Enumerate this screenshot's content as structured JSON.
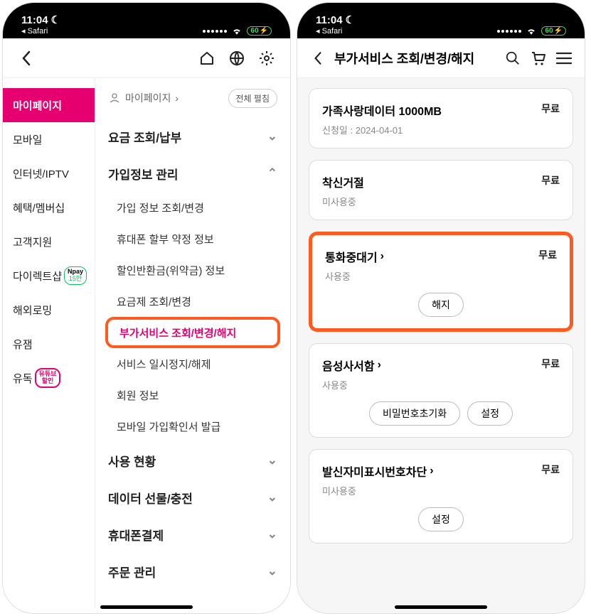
{
  "status": {
    "time": "11:04",
    "back_app": "Safari",
    "battery": "60"
  },
  "left": {
    "sidebar": [
      {
        "label": "마이페이지",
        "active": true
      },
      {
        "label": "모바일"
      },
      {
        "label": "인터넷/IPTV"
      },
      {
        "label": "혜택/멤버십"
      },
      {
        "label": "고객지원"
      },
      {
        "label": "다이렉트샵",
        "badge": "npay",
        "badge_top": "Npay",
        "badge_bot": "15만"
      },
      {
        "label": "해외로밍"
      },
      {
        "label": "유잼"
      },
      {
        "label": "유독",
        "badge": "yt",
        "badge_text": "유튜브\n할인"
      }
    ],
    "crumb": "마이페이지",
    "expand_all": "전체 펼침",
    "sections": [
      {
        "title": "요금 조회/납부",
        "open": false
      },
      {
        "title": "가입정보 관리",
        "open": true,
        "items": [
          "가입 정보 조회/변경",
          "휴대폰 할부 약정 정보",
          "할인반환금(위약금) 정보",
          "요금제 조회/변경",
          "부가서비스 조회/변경/해지",
          "서비스 일시정지/해제",
          "회원 정보",
          "모바일 가입확인서 발급"
        ],
        "highlight_index": 4
      },
      {
        "title": "사용 현황",
        "open": false
      },
      {
        "title": "데이터 선물/충전",
        "open": false
      },
      {
        "title": "휴대폰결제",
        "open": false
      },
      {
        "title": "주문 관리",
        "open": false
      }
    ]
  },
  "right": {
    "page_title": "부가서비스 조회/변경/해지",
    "cards": [
      {
        "title": "가족사랑데이터 1000MB",
        "sub_label": "신청일 : 2024-04-01",
        "price": "무료"
      },
      {
        "title": "착신거절",
        "sub_label": "미사용중",
        "price": "무료"
      },
      {
        "title": "통화중대기",
        "sub_label": "사용중",
        "price": "무료",
        "arrow": true,
        "actions": [
          "해지"
        ],
        "highlight": true
      },
      {
        "title": "음성사서함",
        "sub_label": "사용중",
        "price": "무료",
        "arrow": true,
        "actions": [
          "비밀번호초기화",
          "설정"
        ]
      },
      {
        "title": "발신자미표시번호차단",
        "sub_label": "미사용중",
        "price": "무료",
        "arrow": true,
        "actions": [
          "설정"
        ]
      }
    ]
  }
}
